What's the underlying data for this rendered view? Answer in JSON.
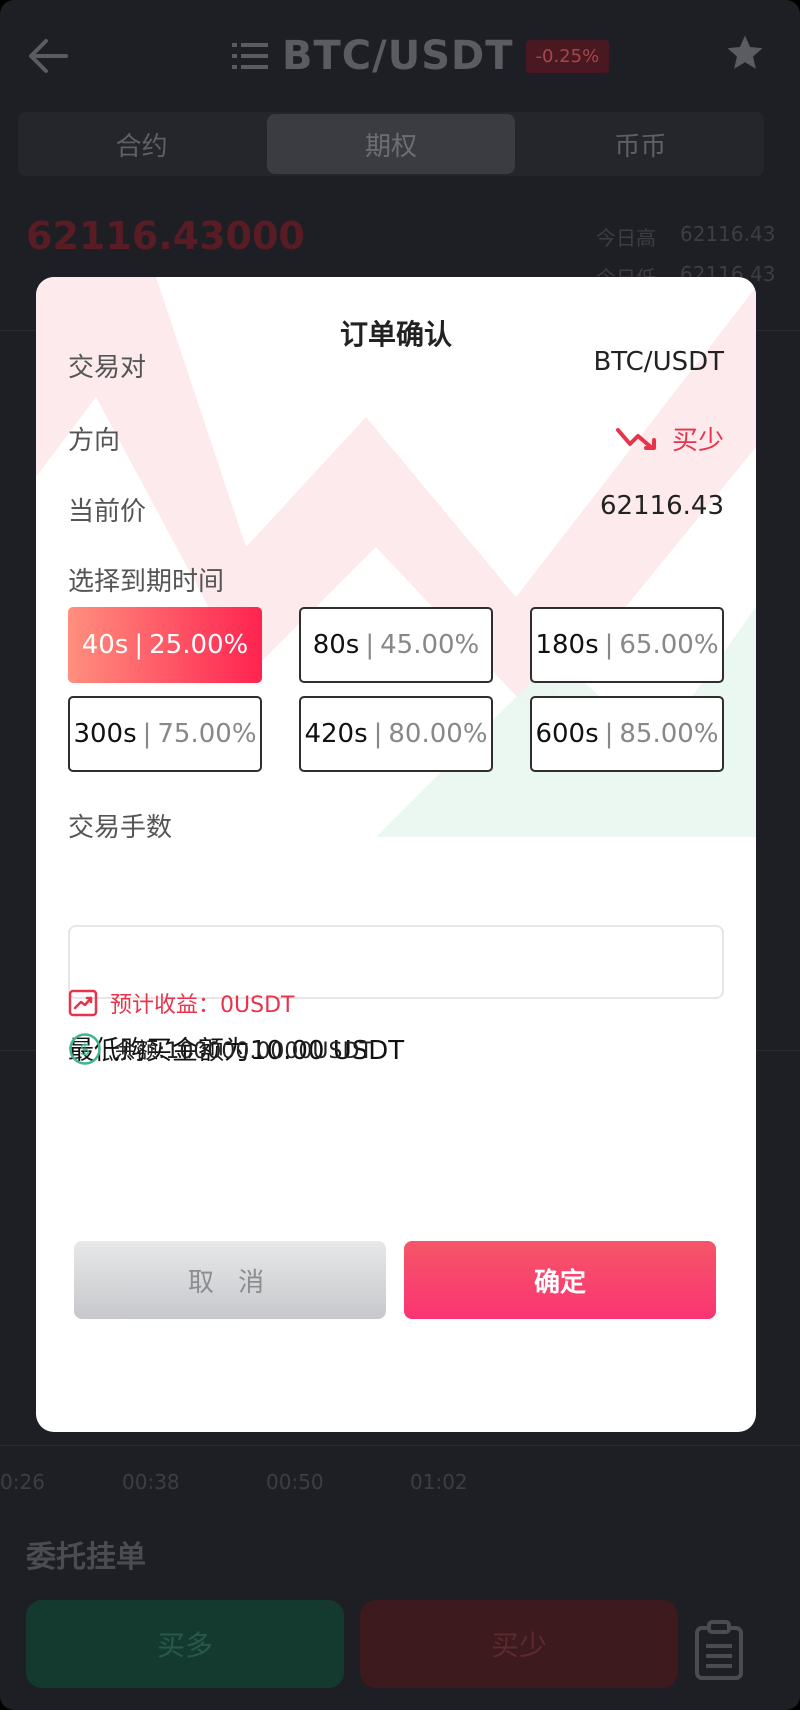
{
  "header": {
    "title": "BTC/USDT",
    "change_badge": "-0.25%"
  },
  "tabs": [
    {
      "label": "合约"
    },
    {
      "label": "期权"
    },
    {
      "label": "币币"
    }
  ],
  "market": {
    "price": "62116.43000",
    "high_label": "今日高",
    "high_value": "62116.43",
    "low_label": "今日低",
    "low_value": "62116.43",
    "time_ticks": [
      "0:26",
      "00:38",
      "00:50",
      "01:02"
    ]
  },
  "bottom": {
    "section_title": "委托挂单",
    "buy_label": "买多",
    "sell_label": "买少"
  },
  "modal": {
    "title": "订单确认",
    "pair_label": "交易对",
    "pair_value": "BTC/USDT",
    "direction_label": "方向",
    "direction_value": "买少",
    "price_label": "当前价",
    "price_value": "62116.43",
    "expiry_label": "选择到期时间",
    "options": [
      {
        "time": "40s",
        "rate": "25.00%",
        "selected": true
      },
      {
        "time": "80s",
        "rate": "45.00%",
        "selected": false
      },
      {
        "time": "180s",
        "rate": "65.00%",
        "selected": false
      },
      {
        "time": "300s",
        "rate": "75.00%",
        "selected": false
      },
      {
        "time": "420s",
        "rate": "80.00%",
        "selected": false
      },
      {
        "time": "600s",
        "rate": "85.00%",
        "selected": false
      }
    ],
    "quantity_label": "交易手数",
    "quantity_value": "",
    "min_buy_text": "最低购买金额为10.00 USDT",
    "expected_profit_text": "预计收益：0USDT",
    "balance_text": "余额:100000.0000USDT",
    "cancel_label": "取 消",
    "confirm_label": "确定"
  },
  "colors": {
    "accent_red": "#e8334b",
    "accent_green": "#3fb68b",
    "confirm_gradient_start": "#f55667",
    "confirm_gradient_end": "#fb3473"
  }
}
